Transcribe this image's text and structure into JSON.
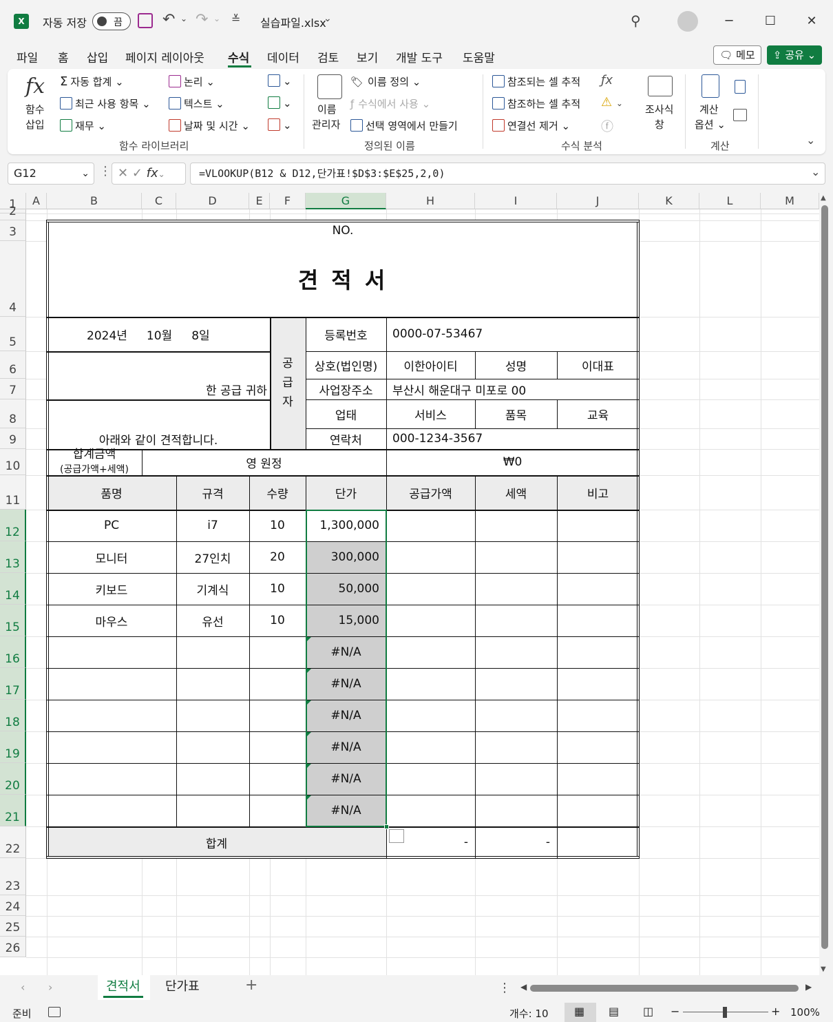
{
  "app": {
    "icon_letter": "X",
    "autosave_label": "자동 저장",
    "autosave_state": "끔",
    "file_name": "실습파일.xlsx",
    "accent": "#107c41"
  },
  "menu": {
    "items": [
      "파일",
      "홈",
      "삽입",
      "페이지 레이아웃",
      "수식",
      "데이터",
      "검토",
      "보기",
      "개발 도구",
      "도움말"
    ],
    "active": "수식",
    "memo": "메모",
    "share": "공유"
  },
  "ribbon": {
    "insert_function": [
      "함수",
      "삽입"
    ],
    "autosum": "자동 합계",
    "recent": "최근 사용 항목",
    "finance": "재무",
    "logic": "논리",
    "text": "텍스트",
    "datetime": "날짜 및 시간",
    "lib_label": "함수 라이브러리",
    "name_manager": [
      "이름",
      "관리자"
    ],
    "define_name": "이름 정의",
    "use_in_formula": "수식에서 사용",
    "create_from_sel": "선택 영역에서 만들기",
    "defined_label": "정의된 이름",
    "trace_precedents": "참조되는 셀 추적",
    "trace_dependents": "참조하는 셀 추적",
    "remove_arrows": "연결선 제거",
    "audit_label": "수식 분석",
    "watch": [
      "조사식",
      "창"
    ],
    "calc_options": [
      "계산",
      "옵션"
    ],
    "calc_label": "계산"
  },
  "formula_bar": {
    "name_box": "G12",
    "formula": "=VLOOKUP(B12 & D12,단가표!$D$3:$E$25,2,0)"
  },
  "columns": [
    "A",
    "B",
    "C",
    "D",
    "E",
    "F",
    "G",
    "H",
    "I",
    "J",
    "K",
    "L",
    "M"
  ],
  "rows": [
    "1",
    "2",
    "3",
    "4",
    "5",
    "6",
    "7",
    "8",
    "9",
    "10",
    "11",
    "12",
    "13",
    "14",
    "15",
    "16",
    "17",
    "18",
    "19",
    "20",
    "21",
    "22",
    "23",
    "24",
    "25",
    "26"
  ],
  "sheet": {
    "no_label": "NO.",
    "title": "견 적 서",
    "date_year": "2024년",
    "date_month": "10월",
    "date_day": "8일",
    "to_suffix": "한 공급 귀하",
    "intro": "아래와 같이 견적합니다.",
    "supplier_vertical": [
      "공",
      "급",
      "자"
    ],
    "reg_no_label": "등록번호",
    "reg_no": "0000-07-53467",
    "company_label": "상호(법인명)",
    "company": "이한아이티",
    "ceo_label": "성명",
    "ceo": "이대표",
    "address_label": "사업장주소",
    "address": "부산시 해운대구 미포로 00",
    "biz_type_label": "업태",
    "biz_type": "서비스",
    "item_kind_label": "품목",
    "item_kind": "교육",
    "contact_label": "연락처",
    "contact": "000-1234-3567",
    "total_label": "합계금액",
    "total_sub": "(공급가액+세액)",
    "total_korean": "영 원정",
    "total_value": "₩0",
    "headers": [
      "품명",
      "규격",
      "수량",
      "단가",
      "공급가액",
      "세액",
      "비고"
    ],
    "items": [
      {
        "name": "PC",
        "spec": "i7",
        "qty": "10",
        "price": "1,300,000"
      },
      {
        "name": "모니터",
        "spec": "27인치",
        "qty": "20",
        "price": "300,000"
      },
      {
        "name": "키보드",
        "spec": "기계식",
        "qty": "10",
        "price": "50,000"
      },
      {
        "name": "마우스",
        "spec": "유선",
        "qty": "10",
        "price": "15,000"
      },
      {
        "name": "",
        "spec": "",
        "qty": "",
        "price": "#N/A"
      },
      {
        "name": "",
        "spec": "",
        "qty": "",
        "price": "#N/A"
      },
      {
        "name": "",
        "spec": "",
        "qty": "",
        "price": "#N/A"
      },
      {
        "name": "",
        "spec": "",
        "qty": "",
        "price": "#N/A"
      },
      {
        "name": "",
        "spec": "",
        "qty": "",
        "price": "#N/A"
      },
      {
        "name": "",
        "spec": "",
        "qty": "",
        "price": "#N/A"
      }
    ],
    "sum_label": "합계",
    "sum_supply": "-",
    "sum_tax": "-"
  },
  "tabs": [
    "견적서",
    "단가표"
  ],
  "active_tab": "견적서",
  "status": {
    "ready": "준비",
    "count": "개수: 10",
    "zoom": "100%"
  }
}
